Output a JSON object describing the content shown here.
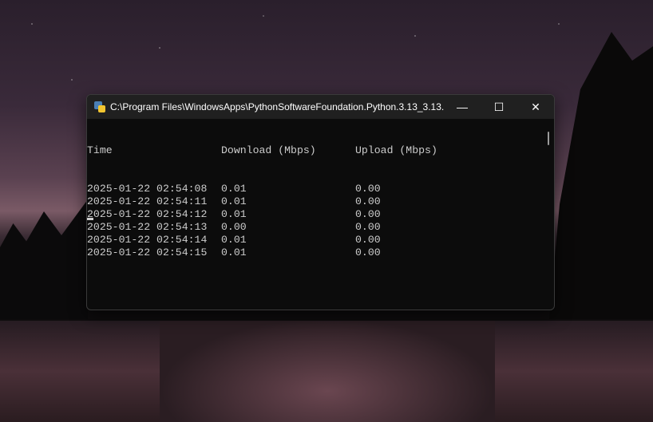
{
  "window": {
    "title": "C:\\Program Files\\WindowsApps\\PythonSoftwareFoundation.Python.3.13_3.13..."
  },
  "console": {
    "headers": [
      "Time",
      "Download (Mbps)",
      "Upload (Mbps)"
    ],
    "rows": [
      [
        "2025-01-22 02:54:08",
        "0.01",
        "0.00"
      ],
      [
        "2025-01-22 02:54:11",
        "0.01",
        "0.00"
      ],
      [
        "2025-01-22 02:54:12",
        "0.01",
        "0.00"
      ],
      [
        "2025-01-22 02:54:13",
        "0.00",
        "0.00"
      ],
      [
        "2025-01-22 02:54:14",
        "0.01",
        "0.00"
      ],
      [
        "2025-01-22 02:54:15",
        "0.01",
        "0.00"
      ]
    ]
  },
  "controls": {
    "minimize": "—",
    "maximize": "☐",
    "close": "✕"
  }
}
